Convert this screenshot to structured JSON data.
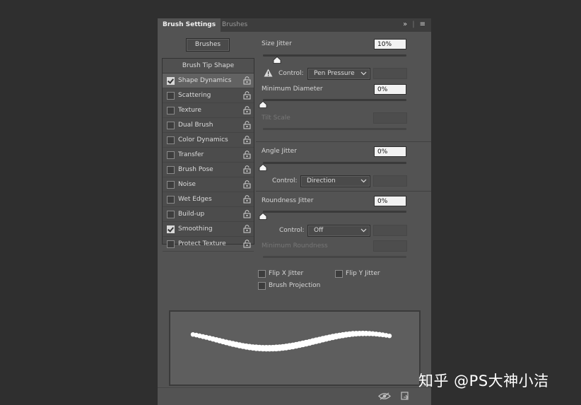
{
  "tabs": {
    "active": "Brush Settings",
    "inactive": "Brushes",
    "expand_icon": "double-chevron-right-icon",
    "menu_icon": "hamburger-menu-icon"
  },
  "brushes_button": "Brushes",
  "brush_tip_shape": "Brush Tip Shape",
  "options": [
    {
      "label": "Shape Dynamics",
      "checked": true,
      "selected": true
    },
    {
      "label": "Scattering",
      "checked": false
    },
    {
      "label": "Texture",
      "checked": false
    },
    {
      "label": "Dual Brush",
      "checked": false
    },
    {
      "label": "Color Dynamics",
      "checked": false
    },
    {
      "label": "Transfer",
      "checked": false
    },
    {
      "label": "Brush Pose",
      "checked": false
    },
    {
      "label": "Noise",
      "checked": false
    },
    {
      "label": "Wet Edges",
      "checked": false
    },
    {
      "label": "Build-up",
      "checked": false
    },
    {
      "label": "Smoothing",
      "checked": true
    },
    {
      "label": "Protect Texture",
      "checked": false
    }
  ],
  "size_jitter": {
    "label": "Size Jitter",
    "value": "10%",
    "slider_fraction": 0.1
  },
  "size_control": {
    "label": "Control:",
    "value": "Pen Pressure"
  },
  "minimum_diameter": {
    "label": "Minimum Diameter",
    "value": "0%",
    "slider_fraction": 0
  },
  "tilt_scale": {
    "label": "Tilt Scale"
  },
  "angle_jitter": {
    "label": "Angle Jitter",
    "value": "0%",
    "slider_fraction": 0
  },
  "angle_control": {
    "label": "Control:",
    "value": "Direction"
  },
  "roundness_jitter": {
    "label": "Roundness Jitter",
    "value": "0%",
    "slider_fraction": 0
  },
  "roundness_control": {
    "label": "Control:",
    "value": "Off"
  },
  "minimum_roundness": {
    "label": "Minimum Roundness"
  },
  "flip_x": "Flip X Jitter",
  "flip_y": "Flip Y Jitter",
  "brush_projection": "Brush Projection",
  "bottom_icons": [
    "eye-toggle-icon",
    "new-preset-icon"
  ],
  "watermark": "知乎 @PS大神小洁"
}
